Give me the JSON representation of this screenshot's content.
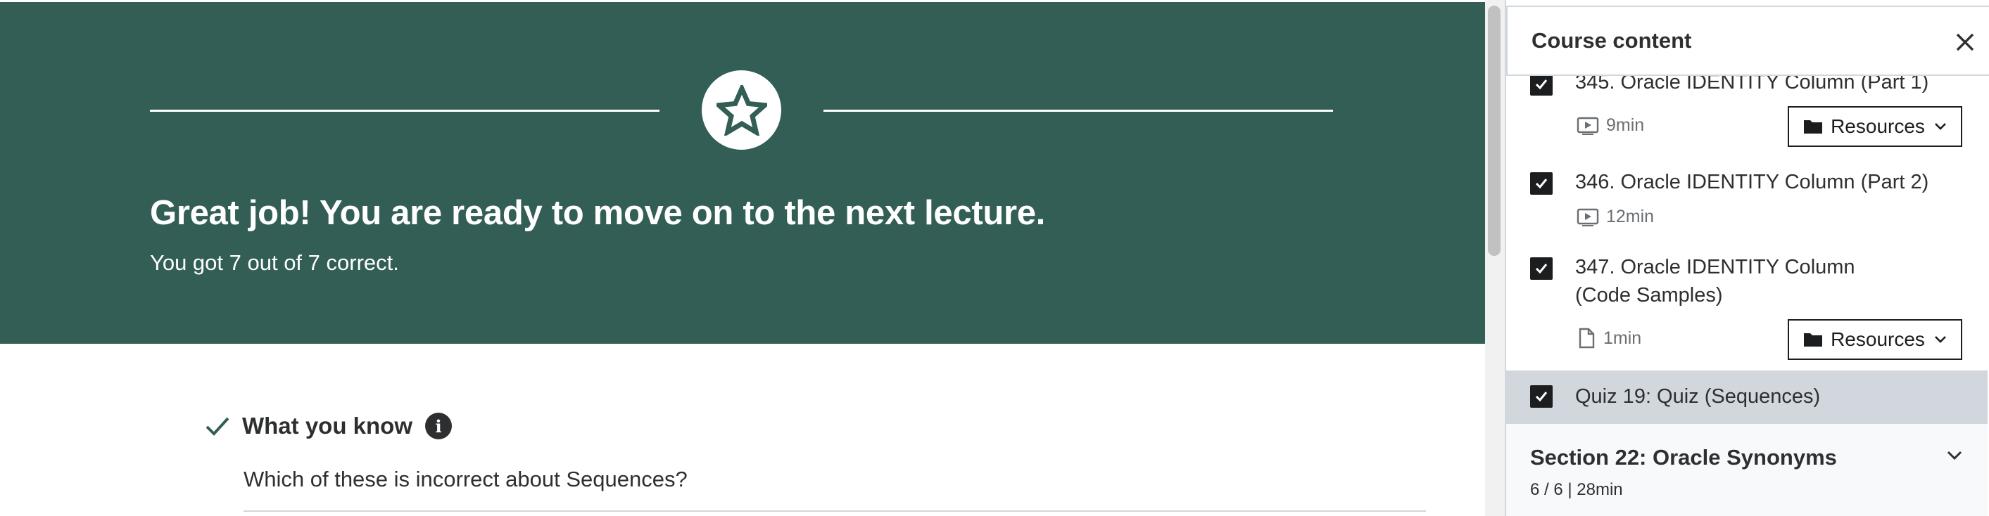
{
  "main": {
    "banner": {
      "title": "Great job! You are ready to move on to the next lecture.",
      "score": "You got 7 out of 7 correct.",
      "icon": "star-icon",
      "color": "#325e55"
    },
    "review": {
      "heading": "What you know",
      "info_icon": "i",
      "question": "Which of these is incorrect about Sequences?"
    }
  },
  "sidebar": {
    "title": "Course content",
    "close_icon": "close-icon",
    "lectures": [
      {
        "title": "345. Oracle IDENTITY Column (Part 1)",
        "type": "video",
        "duration": "9min",
        "resources_label": "Resources",
        "completed": true
      },
      {
        "title": "346. Oracle IDENTITY Column (Part 2)",
        "type": "video",
        "duration": "12min",
        "completed": true
      },
      {
        "title": "347. Oracle IDENTITY Column (Code Samples)",
        "type": "file",
        "duration": "1min",
        "resources_label": "Resources",
        "completed": true
      }
    ],
    "quiz": {
      "title": "Quiz 19: Quiz (Sequences)",
      "completed": true
    },
    "section": {
      "title": "Section 22: Oracle Synonyms",
      "meta": "6 / 6 | 28min"
    }
  }
}
